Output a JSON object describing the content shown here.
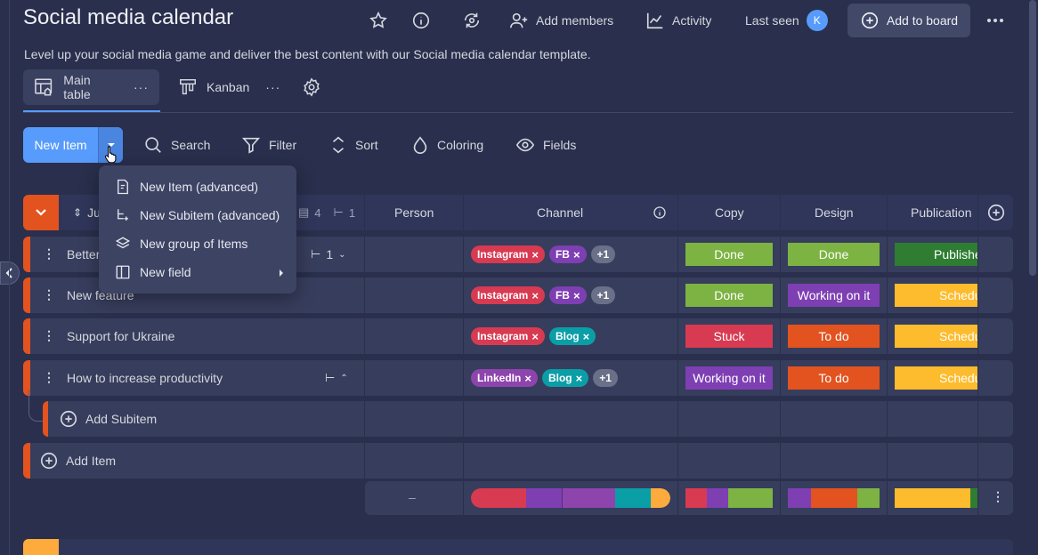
{
  "header": {
    "title": "Social media calendar",
    "description": "Level up your social media game and deliver the best content with our Social media calendar template.",
    "add_members": "Add members",
    "activity": "Activity",
    "last_seen": "Last seen",
    "avatar_initial": "K",
    "add_to_board": "Add to board"
  },
  "tabs": [
    {
      "label": "Main table",
      "active": true
    },
    {
      "label": "Kanban",
      "active": false
    }
  ],
  "toolbar": {
    "new_item": "New Item",
    "search": "Search",
    "filter": "Filter",
    "sort": "Sort",
    "coloring": "Coloring",
    "fields": "Fields"
  },
  "dropdown_menu": [
    {
      "label": "New Item (advanced)",
      "icon": "doc-add-icon"
    },
    {
      "label": "New Subitem (advanced)",
      "icon": "subitem-icon"
    },
    {
      "label": "New group of Items",
      "icon": "layers-icon"
    },
    {
      "label": "New field",
      "icon": "column-icon",
      "has_submenu": true
    }
  ],
  "group": {
    "name_partial": "Ju",
    "docs_count": "4",
    "subitems_count": "1",
    "columns": [
      "Person",
      "Channel",
      "Copy",
      "Design",
      "Publication"
    ]
  },
  "rows": [
    {
      "name": "Better",
      "subitems": "1",
      "channels": [
        "Instagram",
        "FB"
      ],
      "more": "+1",
      "copy": "Done",
      "design": "Done",
      "publication": "Published"
    },
    {
      "name": "New feature",
      "channels": [
        "Instagram",
        "FB"
      ],
      "more": "+1",
      "copy": "Done",
      "design": "Working on it",
      "publication": "Scheduled"
    },
    {
      "name": "Support for Ukraine",
      "channels": [
        "Instagram",
        "Blog"
      ],
      "copy": "Stuck",
      "design": "To do",
      "publication": "Scheduled"
    },
    {
      "name": "How to increase productivity",
      "channels": [
        "LinkedIn",
        "Blog"
      ],
      "more": "+1",
      "copy": "Working on it",
      "design": "To do",
      "publication": "Scheduled"
    }
  ],
  "add_subitem": "Add Subitem",
  "add_item": "Add Item",
  "summary_person": "–",
  "colors": {
    "background": "#292f4c",
    "accent": "#579bfc",
    "group": "#e2445c",
    "done": "#7cb342",
    "working": "#7e3fb3",
    "stuck": "#d83a52",
    "todo": "#e2531f",
    "scheduled": "#fdbc2d",
    "published": "#2e7d32",
    "instagram": "#d83a52",
    "fb": "#7e3fb3",
    "blog": "#0a9ea7",
    "linkedin": "#8e44ad"
  }
}
